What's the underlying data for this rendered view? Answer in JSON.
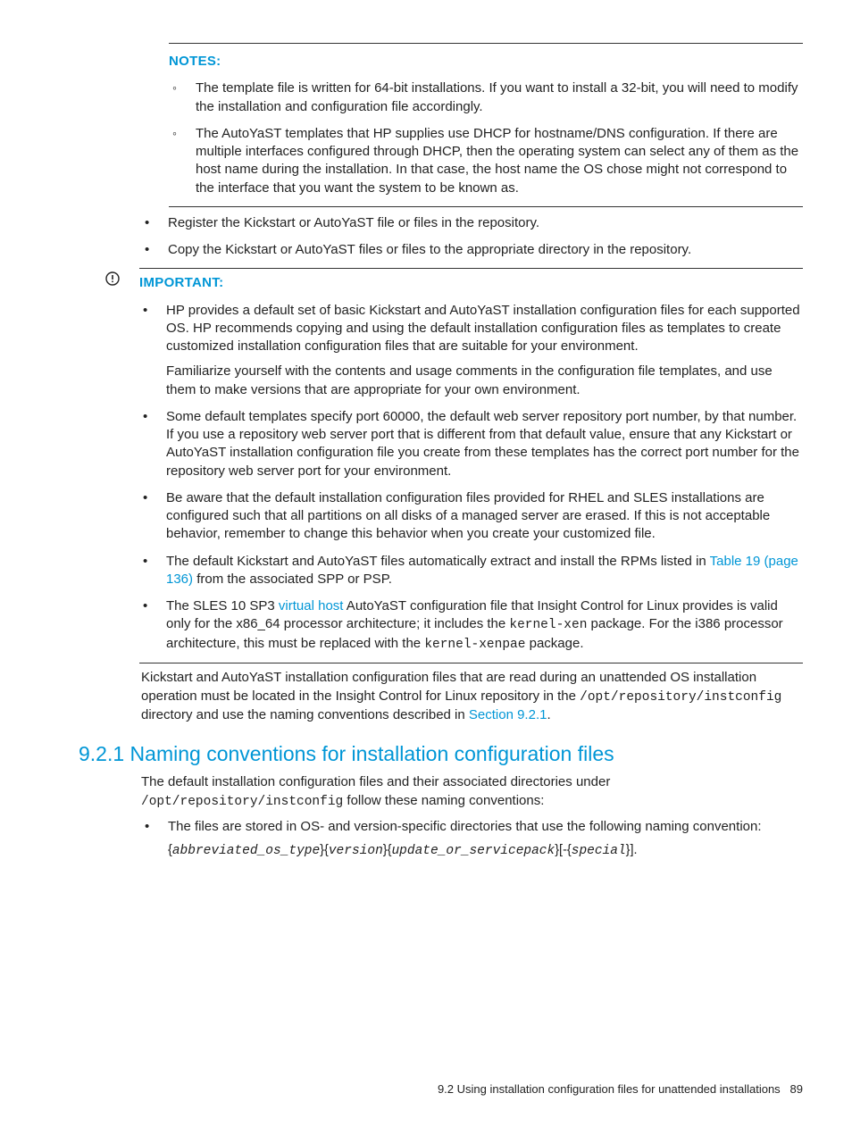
{
  "notes": {
    "heading": "NOTES:",
    "items": [
      "The template file is written for 64-bit installations. If you want to install a 32-bit, you will need to modify the installation and configuration file accordingly.",
      "The AutoYaST templates that HP supplies use DHCP for hostname/DNS configuration. If there are multiple interfaces configured through DHCP, then the operating system can select any of them as the host name during the installation. In that case, the host name the OS chose might not correspond to the interface that you want the system to be known as."
    ]
  },
  "outer_bullets": [
    "Register the Kickstart or AutoYaST file or files in the repository.",
    "Copy the Kickstart or AutoYaST files or files to the appropriate directory in the repository."
  ],
  "important": {
    "heading": "IMPORTANT:",
    "items": [
      {
        "text": "HP provides a default set of basic Kickstart and AutoYaST installation configuration files for each supported OS. HP recommends copying and using the default installation configuration files as templates to create customized installation configuration files that are suitable for your environment.",
        "sub": "Familiarize yourself with the contents and usage comments in the configuration file templates, and use them to make versions that are appropriate for your own environment."
      },
      {
        "text": "Some default templates specify port 60000, the default web server repository port number, by that number. If you use a repository web server port that is different from that default value, ensure that any Kickstart or AutoYaST installation configuration file you create from these templates has the correct port number for the repository web server port for your environment."
      },
      {
        "text": "Be aware that the default installation configuration files provided for RHEL and SLES installations are configured such that all partitions on all disks of a managed server are erased. If this is not acceptable behavior, remember to change this behavior when you create your customized file."
      },
      {
        "pre": "The default Kickstart and AutoYaST files automatically extract and install the RPMs listed in ",
        "link": "Table 19 (page 136)",
        "post": " from the associated SPP or PSP."
      },
      {
        "pre2": "The SLES 10 SP3 ",
        "link2": "virtual host",
        "mid2a": " AutoYaST configuration file that Insight Control for Linux provides is valid only for the x86_64 processor architecture; it includes the ",
        "code2a": "kernel-xen",
        "mid2b": " package. For the i386 processor architecture, this must be replaced with the ",
        "code2b": "kernel-xenpae",
        "post2": " package."
      }
    ]
  },
  "para1": {
    "pre": "Kickstart and AutoYaST installation configuration files that are read during an unattended OS installation operation must be located in the Insight Control for Linux repository in the ",
    "code": "/opt/repository/instconfig",
    "mid": " directory and use the naming conventions described in ",
    "link": "Section 9.2.1",
    "post": "."
  },
  "section": {
    "heading": "9.2.1 Naming conventions for installation configuration files"
  },
  "para2": {
    "pre": "The default installation configuration files and their associated directories under ",
    "code": "/opt/repository/instconfig",
    "post": " follow these naming conventions:"
  },
  "conv_bullet": "The files are stored in OS- and version-specific directories that use the following naming convention:",
  "code_line": {
    "b1": "{",
    "v1": "abbreviated_os_type",
    "b2": "}{",
    "v2": "version",
    "b3": "}{",
    "v3": "update_or_servicepack",
    "b4": "}[-{",
    "v4": "special",
    "b5": "}]."
  },
  "footer": {
    "text": "9.2 Using installation configuration files for unattended installations",
    "page": "89"
  }
}
